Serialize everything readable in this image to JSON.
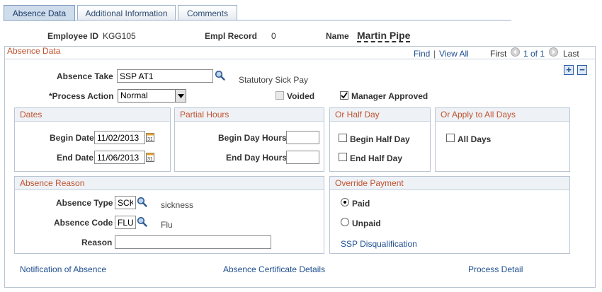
{
  "tabs": [
    {
      "label": "Absence Data",
      "active": true
    },
    {
      "label": "Additional Information",
      "active": false
    },
    {
      "label": "Comments",
      "active": false
    }
  ],
  "header": {
    "employee_id_label": "Employee ID",
    "employee_id": "KGG105",
    "empl_record_label": "Empl Record",
    "empl_record": "0",
    "name_label": "Name",
    "name": "Martin Pipe"
  },
  "absence": {
    "section_title": "Absence Data",
    "find": "Find",
    "sep": "|",
    "view_all": "View All",
    "first": "First",
    "page_info": "1 of 1",
    "last": "Last",
    "add_label": "+",
    "remove_label": "−",
    "absence_take_label": "Absence Take",
    "absence_take_value": "SSP AT1",
    "absence_take_desc": "Statutory Sick Pay",
    "process_action_label": "*Process Action",
    "process_action_value": "Normal",
    "voided_label": "Voided",
    "manager_approved_label": "Manager Approved"
  },
  "dates": {
    "title": "Dates",
    "begin_label": "Begin Date",
    "begin_value": "11/02/2013",
    "end_label": "End Date",
    "end_value": "11/06/2013"
  },
  "partial_hours": {
    "title": "Partial Hours",
    "begin_label": "Begin Day Hours",
    "end_label": "End Day Hours"
  },
  "half_day": {
    "title": "Or Half Day",
    "begin_label": "Begin Half Day",
    "end_label": "End Half Day"
  },
  "all_days": {
    "title": "Or Apply to All Days",
    "label": "All Days"
  },
  "reason": {
    "title": "Absence Reason",
    "type_label": "Absence Type",
    "type_value": "SCK",
    "type_desc": "sickness",
    "code_label": "Absence Code",
    "code_value": "FLU",
    "code_desc": "Flu",
    "reason_label": "Reason",
    "reason_value": ""
  },
  "payment": {
    "title": "Override Payment",
    "paid_label": "Paid",
    "unpaid_label": "Unpaid",
    "ssp_link": "SSP Disqualification"
  },
  "footer": {
    "notification": "Notification of Absence",
    "certificate": "Absence Certificate Details",
    "process_detail": "Process Detail"
  },
  "colors": {
    "section_title": "#c0522f",
    "link": "#1f4f91",
    "border": "#b9c5d2"
  }
}
